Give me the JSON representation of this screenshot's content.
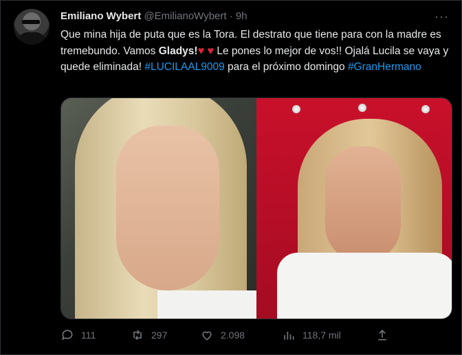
{
  "author": {
    "name": "Emiliano Wybert",
    "handle": "@EmilianoWybert",
    "separator": "·",
    "time": "9h"
  },
  "more_icon": "more-icon",
  "tweet": {
    "part1": "Que mina hija de puta que es la Tora. El destrato que tiene para con la madre es tremebundo. Vamos ",
    "bold": "Gladys!",
    "hearts": "♥ ♥",
    "part2": " Le pones lo mejor de vos!! Ojalá Lucila se vaya y quede eliminada! ",
    "hashtag1": "#LUCILAAL9009",
    "part3": " para el próximo domingo ",
    "hashtag2": "#GranHermano"
  },
  "actions": {
    "replies": "111",
    "retweets": "297",
    "likes": "2.098",
    "views": "118,7 mil"
  },
  "colors": {
    "background": "#000000",
    "text": "#e7e9ea",
    "muted": "#71767b",
    "link": "#1d9bf0",
    "heart": "#e0243a"
  }
}
